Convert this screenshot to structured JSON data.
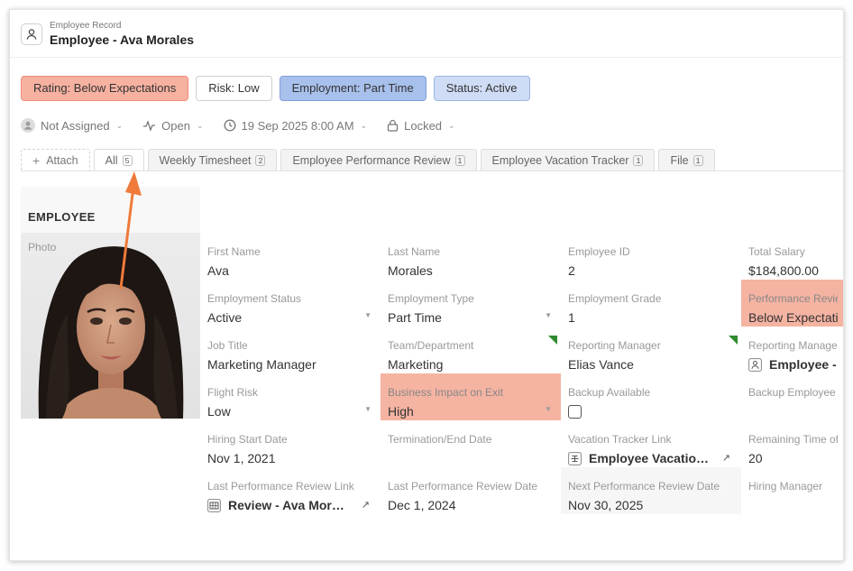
{
  "header": {
    "subtitle": "Employee Record",
    "title": "Employee - Ava Morales"
  },
  "badges": {
    "rating": "Rating: Below Expectations",
    "risk": "Risk: Low",
    "employment": "Employment: Part Time",
    "status": "Status: Active"
  },
  "meta": {
    "assignee": "Not Assigned",
    "state": "Open",
    "datetime": "19 Sep 2025 8:00 AM",
    "lock": "Locked"
  },
  "tabs": {
    "attach": "Attach",
    "items": [
      {
        "label": "All",
        "count": "5"
      },
      {
        "label": "Weekly Timesheet",
        "count": "2"
      },
      {
        "label": "Employee Performance Review",
        "count": "1"
      },
      {
        "label": "Employee Vacation Tracker",
        "count": "1"
      },
      {
        "label": "File",
        "count": "1"
      }
    ]
  },
  "section": {
    "title": "EMPLOYEE",
    "photo_label": "Photo"
  },
  "fields": {
    "first_name": {
      "label": "First Name",
      "value": "Ava"
    },
    "last_name": {
      "label": "Last Name",
      "value": "Morales"
    },
    "employee_id": {
      "label": "Employee ID",
      "value": "2"
    },
    "total_salary": {
      "label": "Total Salary",
      "value": "$184,800.00"
    },
    "employment_status": {
      "label": "Employment Status",
      "value": "Active"
    },
    "employment_type": {
      "label": "Employment Type",
      "value": "Part Time"
    },
    "employment_grade": {
      "label": "Employment Grade",
      "value": "1"
    },
    "performance_review": {
      "label": "Performance Revie",
      "value": "Below Expectatio"
    },
    "job_title": {
      "label": "Job Title",
      "value": "Marketing Manager"
    },
    "team_department": {
      "label": "Team/Department",
      "value": "Marketing"
    },
    "reporting_manager": {
      "label": "Reporting Manager",
      "value": "Elias Vance"
    },
    "reporting_manager_link": {
      "label": "Reporting Manage",
      "value": "Employee -"
    },
    "flight_risk": {
      "label": "Flight Risk",
      "value": "Low"
    },
    "business_impact": {
      "label": "Business Impact on Exit",
      "value": "High"
    },
    "backup_available": {
      "label": "Backup Available"
    },
    "backup_employee": {
      "label": "Backup Employee"
    },
    "hiring_start_date": {
      "label": "Hiring Start Date",
      "value": "Nov 1, 2021"
    },
    "termination_date": {
      "label": "Termination/End Date"
    },
    "vacation_tracker_link": {
      "label": "Vacation Tracker Link",
      "value": "Employee Vacatio…"
    },
    "remaining_time": {
      "label": "Remaining Time of",
      "value": "20"
    },
    "last_review_link": {
      "label": "Last Performance Review Link",
      "value": "Review - Ava Mor…"
    },
    "last_review_date": {
      "label": "Last Performance Review Date",
      "value": "Dec 1, 2024"
    },
    "next_review_date": {
      "label": "Next Performance Review Date",
      "value": "Nov 30, 2025"
    },
    "hiring_manager": {
      "label": "Hiring Manager"
    }
  },
  "colors": {
    "highlight": "#f5b3a2",
    "rating_badge": "#f6b1a1",
    "employment_badge": "#a8c0ec",
    "status_badge": "#cfdcf5",
    "annotation_arrow": "#f07a3a",
    "flag_green": "#2e8b2e"
  }
}
